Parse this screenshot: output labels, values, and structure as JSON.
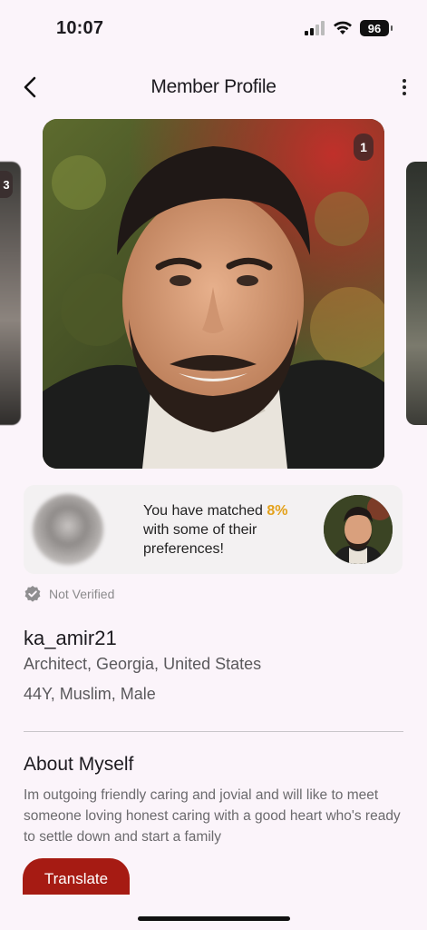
{
  "status_bar": {
    "time": "10:07",
    "battery": "96"
  },
  "header": {
    "title": "Member Profile"
  },
  "carousel": {
    "current_badge": "1",
    "left_badge": "3"
  },
  "match_card": {
    "text_before": "You have matched ",
    "percent": "8%",
    "text_after": " with some of their preferences!",
    "accent_color": "#e3a11a"
  },
  "verification": {
    "label": "Not Verified"
  },
  "profile": {
    "username": "ka_amir21",
    "occupation_location": "Architect, Georgia, United States",
    "demographics": "44Y, Muslim, Male"
  },
  "about": {
    "title": "About Myself",
    "text": "Im outgoing friendly caring and jovial and will like to meet someone loving honest caring with a good heart who's ready to settle down and start a family"
  },
  "actions": {
    "translate_label": "Translate",
    "translate_color": "#a61b13"
  },
  "icons": [
    "signal-icon",
    "wifi-icon",
    "battery-icon",
    "back-icon",
    "more-icon",
    "verified-badge-icon"
  ]
}
